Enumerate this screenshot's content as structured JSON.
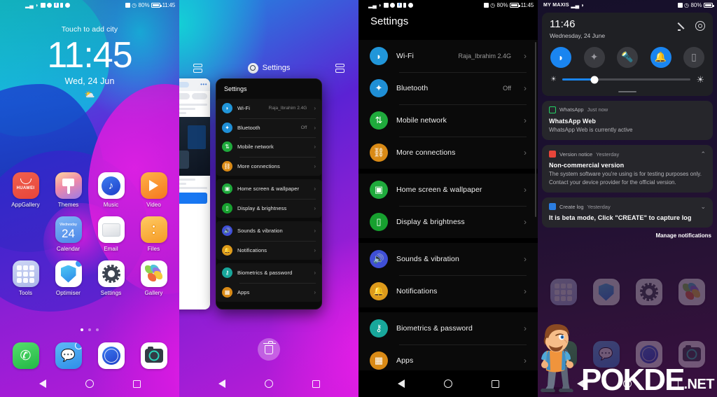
{
  "statusbar": {
    "time": "11:45",
    "battery_percent": "80%",
    "carrier": "MY MAXIS",
    "icons": [
      "signal-icon",
      "wifi-icon",
      "sim-icon",
      "whatsapp-icon",
      "facebook-icon",
      "battery-saver-icon",
      "message-icon"
    ],
    "right_icons": [
      "nfc-icon",
      "dnd-icon"
    ]
  },
  "panel1": {
    "name": "home-screen",
    "lock_hint": "Touch to add city",
    "clock": "11:45",
    "date": "Wed, 24 Jun",
    "weather_icon": "partly-cloudy-icon",
    "apps": [
      {
        "label": "AppGallery",
        "icon": "appgallery-icon"
      },
      {
        "label": "Themes",
        "icon": "themes-icon"
      },
      {
        "label": "Music",
        "icon": "music-icon"
      },
      {
        "label": "Video",
        "icon": "video-icon"
      },
      {
        "label": "",
        "icon": "empty"
      },
      {
        "label": "Calendar",
        "icon": "calendar-icon",
        "day_name": "Wednesday",
        "day_num": "24"
      },
      {
        "label": "Email",
        "icon": "email-icon"
      },
      {
        "label": "Files",
        "icon": "files-icon"
      },
      {
        "label": "Tools",
        "icon": "tools-folder-icon"
      },
      {
        "label": "Optimiser",
        "icon": "optimiser-icon"
      },
      {
        "label": "Settings",
        "icon": "settings-gear-icon"
      },
      {
        "label": "Gallery",
        "icon": "gallery-icon"
      }
    ],
    "dock": [
      {
        "label": "Phone",
        "icon": "phone-icon"
      },
      {
        "label": "Messages",
        "icon": "messages-icon"
      },
      {
        "label": "Browser",
        "icon": "browser-icon"
      },
      {
        "label": "Camera",
        "icon": "camera-icon"
      }
    ],
    "page_dots": 3,
    "active_dot": 0
  },
  "panel2": {
    "name": "recent-apps-floating-window",
    "recents_title": "Settings",
    "split_icon_left": "split-screen-icon",
    "split_icon_right": "split-screen-icon",
    "window_title": "Settings",
    "trash_icon": "trash-icon",
    "rows": [
      {
        "label": "Wi-Fi",
        "value": "Raja_Ibrahim 2.4G",
        "icon": "wifi-icon"
      },
      {
        "label": "Bluetooth",
        "value": "Off",
        "icon": "bluetooth-icon"
      },
      {
        "label": "Mobile network",
        "value": "",
        "icon": "mobile-network-icon"
      },
      {
        "label": "More connections",
        "value": "",
        "icon": "link-icon"
      },
      {
        "label": "Home screen & wallpaper",
        "value": "",
        "icon": "wallpaper-icon"
      },
      {
        "label": "Display & brightness",
        "value": "",
        "icon": "display-icon"
      },
      {
        "label": "Sounds & vibration",
        "value": "",
        "icon": "sound-icon"
      },
      {
        "label": "Notifications",
        "value": "",
        "icon": "bell-icon"
      },
      {
        "label": "Biometrics & password",
        "value": "",
        "icon": "key-icon"
      },
      {
        "label": "Apps",
        "value": "",
        "icon": "apps-grid-icon"
      }
    ]
  },
  "panel3": {
    "name": "settings-app",
    "title": "Settings",
    "groups": [
      [
        {
          "label": "Wi-Fi",
          "value": "Raja_Ibrahim 2.4G",
          "icon": "wifi-icon",
          "color": "#2196d9"
        },
        {
          "label": "Bluetooth",
          "value": "Off",
          "icon": "bluetooth-icon",
          "color": "#1f8fd6"
        },
        {
          "label": "Mobile network",
          "value": "",
          "icon": "mobile-network-icon",
          "color": "#1faa3c"
        },
        {
          "label": "More connections",
          "value": "",
          "icon": "link-icon",
          "color": "#d98a16"
        }
      ],
      [
        {
          "label": "Home screen & wallpaper",
          "value": "",
          "icon": "wallpaper-icon",
          "color": "#1faa3c"
        },
        {
          "label": "Display & brightness",
          "value": "",
          "icon": "display-icon",
          "color": "#17a02f"
        }
      ],
      [
        {
          "label": "Sounds & vibration",
          "value": "",
          "icon": "sound-icon",
          "color": "#3f4fd6"
        },
        {
          "label": "Notifications",
          "value": "",
          "icon": "bell-icon",
          "color": "#dd9a1b"
        }
      ],
      [
        {
          "label": "Biometrics & password",
          "value": "",
          "icon": "key-icon",
          "color": "#18a79b"
        },
        {
          "label": "Apps",
          "value": "",
          "icon": "apps-grid-icon",
          "color": "#d98a16"
        }
      ]
    ]
  },
  "panel4": {
    "name": "notification-shade",
    "time": "11:46",
    "date": "Wednesday, 24 June",
    "edit_icon": "pencil-icon",
    "settings_icon": "gear-icon",
    "toggles": [
      {
        "name": "wifi-toggle",
        "icon": "wifi-icon",
        "on": true
      },
      {
        "name": "bluetooth-toggle",
        "icon": "bluetooth-icon",
        "on": false
      },
      {
        "name": "flashlight-toggle",
        "icon": "flashlight-icon",
        "on": false
      },
      {
        "name": "ringer-toggle",
        "icon": "bell-icon",
        "on": true
      },
      {
        "name": "vibrate-toggle",
        "icon": "vibrate-icon",
        "on": false
      }
    ],
    "brightness_percent": 25,
    "notifications": [
      {
        "app": "WhatsApp",
        "time": "Just now",
        "title": "WhatsApp Web",
        "body": "WhatsApp Web is currently active",
        "icon": "whatsapp-web-icon",
        "collapse": ""
      },
      {
        "app": "Version notice",
        "time": "Yesterday",
        "title": "Non-commercial version",
        "body": "The system software you're using is for testing purposes only. Contact your device provider for the official version.",
        "icon": "huawei-icon",
        "collapse": "chevron-up-icon"
      },
      {
        "app": "Create log",
        "time": "Yesterday",
        "title": "It is beta mode, Click \"CREATE\" to capture log",
        "body": "",
        "icon": "log-icon",
        "collapse": "chevron-down-icon"
      }
    ],
    "manage_label": "Manage notifications"
  },
  "watermark": {
    "brand": "POKDE",
    "suffix": ".NET",
    "mascot": "pokde-mascot-icon"
  },
  "navbar": {
    "back": "back-icon",
    "home": "home-icon",
    "recents": "recents-icon"
  }
}
